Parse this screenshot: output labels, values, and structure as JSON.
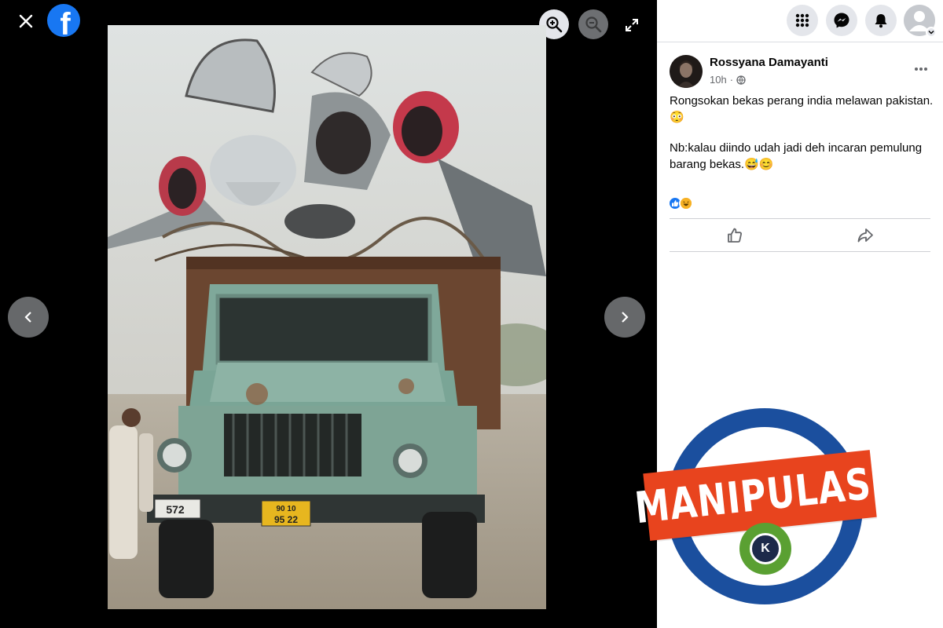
{
  "viewer": {
    "logo_letter": "f",
    "icons": {
      "close": "close-icon",
      "zoom_in": "zoom-in-icon",
      "zoom_out": "zoom-out-icon",
      "expand": "expand-icon",
      "prev": "chevron-left-icon",
      "next": "chevron-right-icon"
    },
    "photo": {
      "plate_left": "572",
      "plate_right_top": "90 10",
      "plate_right_bottom": "95 22"
    }
  },
  "topbar": {
    "icons": [
      "apps-grid-icon",
      "messenger-icon",
      "bell-icon",
      "account-avatar-icon"
    ]
  },
  "post": {
    "author": "Rossyana Damayanti",
    "time": "10h",
    "paragraphs": [
      "Rongsokan bekas perang india melawan pakistan.😳",
      "Nb:kalau diindo udah jadi deh incaran pemulung barang bekas.😅😊"
    ],
    "reactions": [
      "like",
      "haha"
    ]
  },
  "stamp": {
    "label": "MANIPULASI",
    "badge_text": "K"
  },
  "colors": {
    "brand": "#1877f2",
    "stamp_ring": "#1b4f9e",
    "stamp_banner": "#e8441e",
    "stamp_badge": "#5aa032"
  }
}
